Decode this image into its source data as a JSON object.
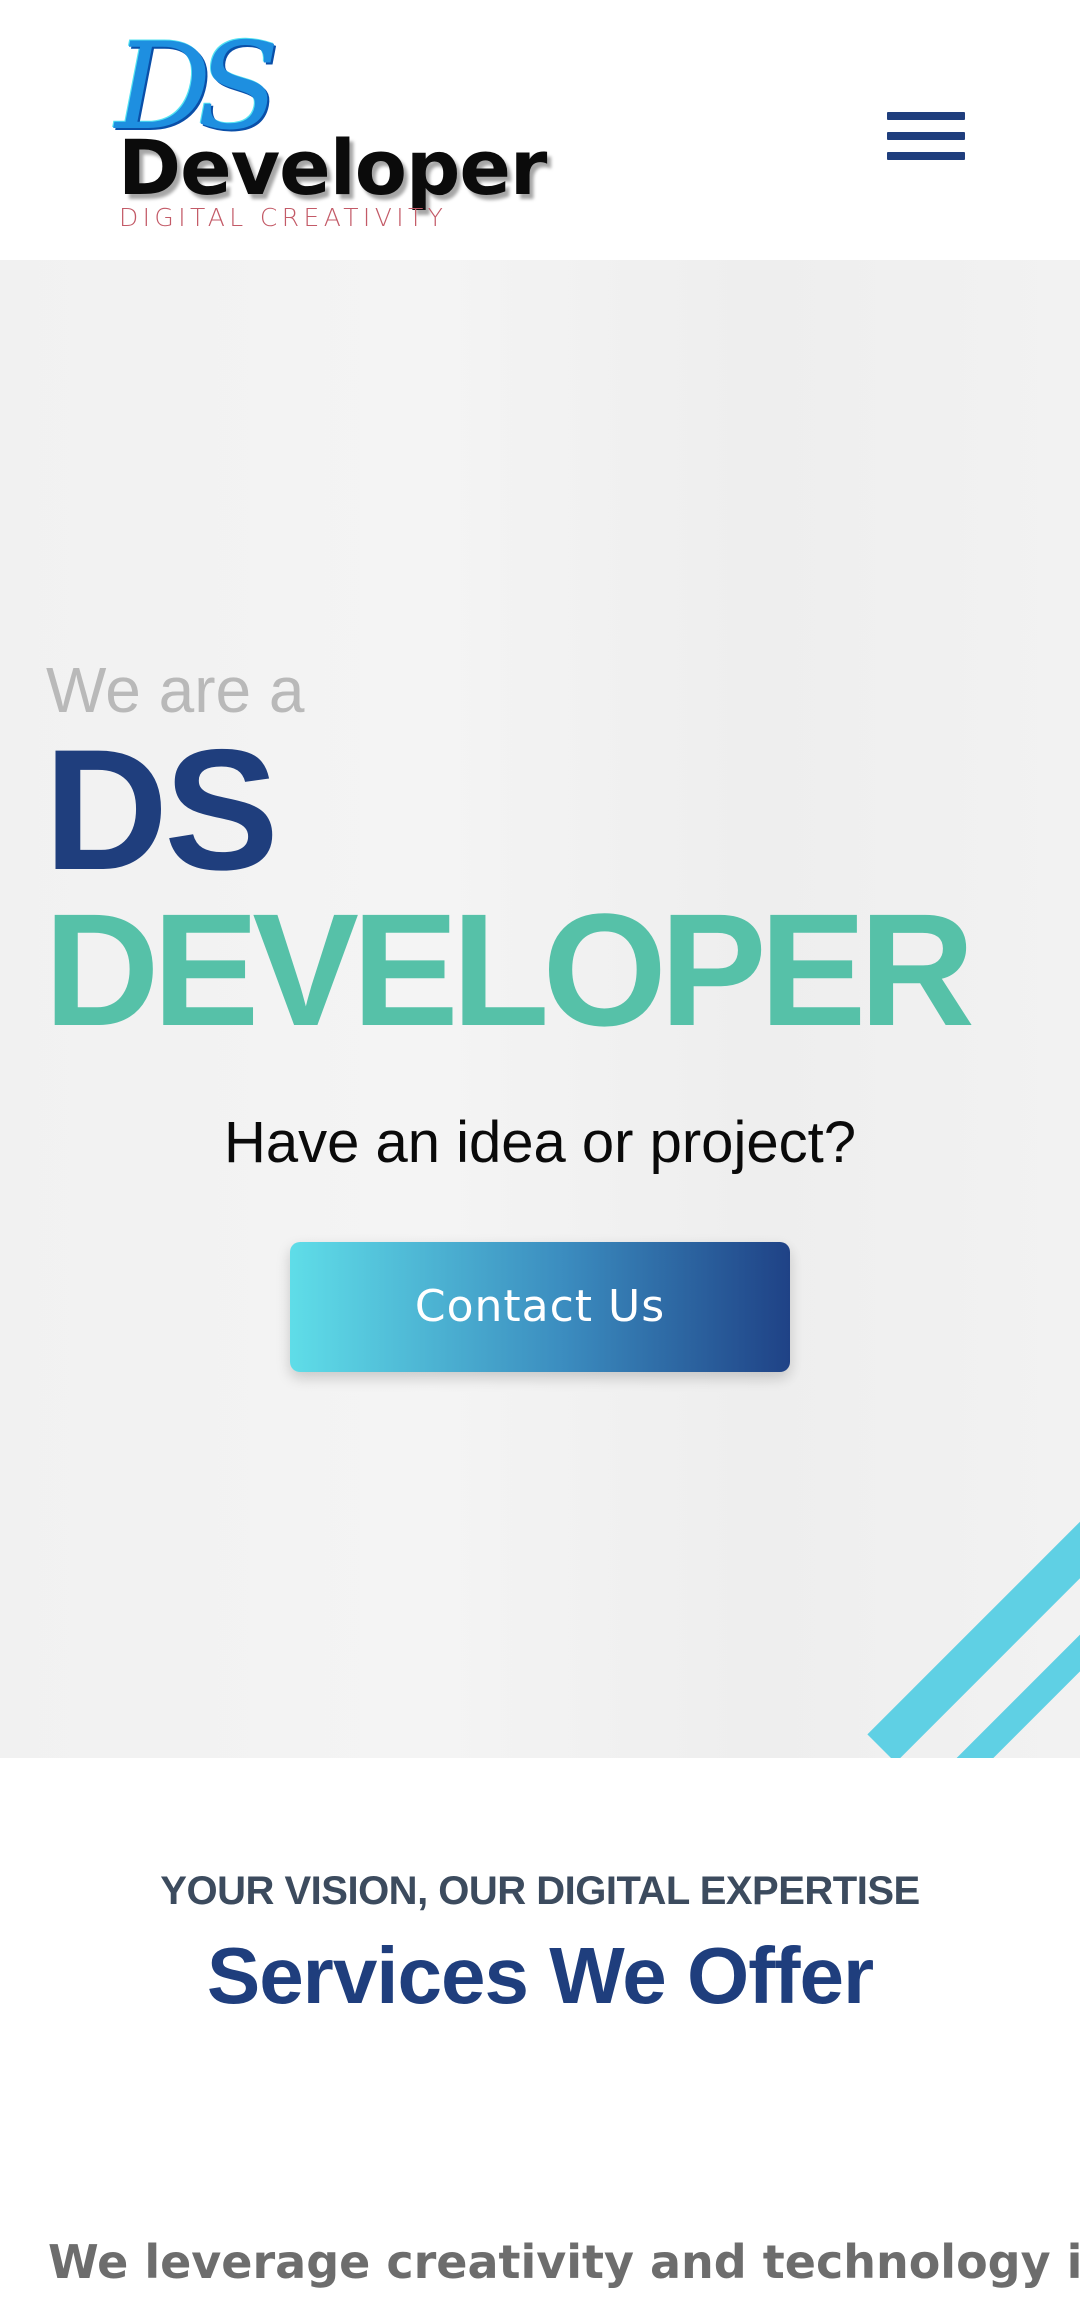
{
  "header": {
    "logo": {
      "monogram": "DS",
      "wordmark": "Developer",
      "tagline": "DIGITAL CREATIVITY"
    },
    "menu_icon": "hamburger-menu-icon"
  },
  "hero": {
    "intro": "We are a",
    "title_line1": "DS",
    "title_line2": "DEVELOPER",
    "question": "Have an idea or project?",
    "cta_label": "Contact Us"
  },
  "services": {
    "eyebrow": "YOUR VISION, OUR DIGITAL EXPERTISE",
    "title": "Services We Offer",
    "intro_text": "We leverage creativity and technology in"
  },
  "colors": {
    "brand_navy": "#1f3e7d",
    "brand_green": "#56c1a8",
    "accent_cyan": "#5fd0e4"
  }
}
